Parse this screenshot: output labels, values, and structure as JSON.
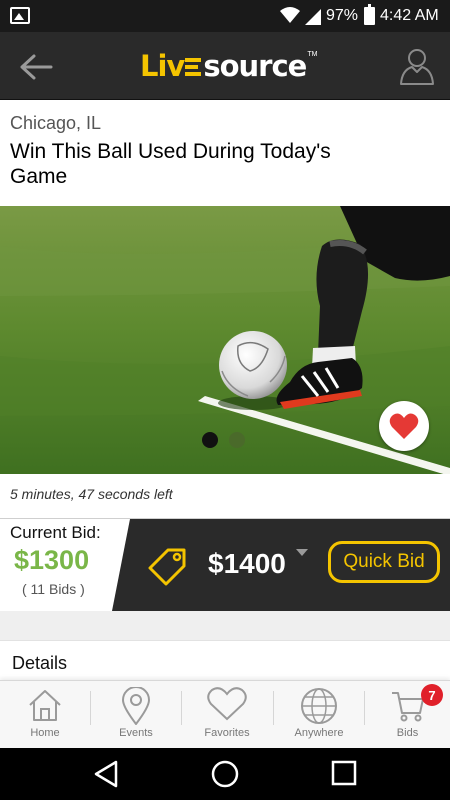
{
  "status_bar": {
    "battery": "97%",
    "time": "4:42 AM",
    "icons": [
      "image-icon",
      "wifi-icon",
      "signal-icon",
      "battery-icon"
    ]
  },
  "app_bar": {
    "logo_part1": "Liv",
    "logo_part2": "source",
    "logo_tm": "TM",
    "back_icon": "back-arrow-icon",
    "profile_icon": "profile-icon"
  },
  "listing": {
    "location": "Chicago, IL",
    "title": "Win This Ball Used During Today's Game",
    "carousel": {
      "pages": 2,
      "active": 1
    },
    "favorite_icon": "heart-icon",
    "time_left": "5 minutes, 47 seconds left"
  },
  "bid": {
    "current_label": "Current Bid:",
    "current_value": "$1300",
    "bid_count": "( 11 Bids )",
    "next_bid": "$1400",
    "quick_bid_label": "Quick Bid",
    "tag_icon": "price-tag-icon"
  },
  "details": {
    "heading": "Details"
  },
  "bottom_nav": {
    "items": [
      {
        "label": "Home",
        "icon": "home-icon"
      },
      {
        "label": "Events",
        "icon": "map-pin-icon"
      },
      {
        "label": "Favorites",
        "icon": "heart-outline-icon"
      },
      {
        "label": "Anywhere",
        "icon": "globe-icon"
      },
      {
        "label": "Bids",
        "icon": "cart-icon",
        "badge": "7"
      }
    ]
  },
  "colors": {
    "accent": "#f4c400",
    "bid_green": "#7ab648",
    "dark": "#2a2a2a",
    "favorite_red": "#e53935",
    "badge_red": "#e0202a"
  }
}
